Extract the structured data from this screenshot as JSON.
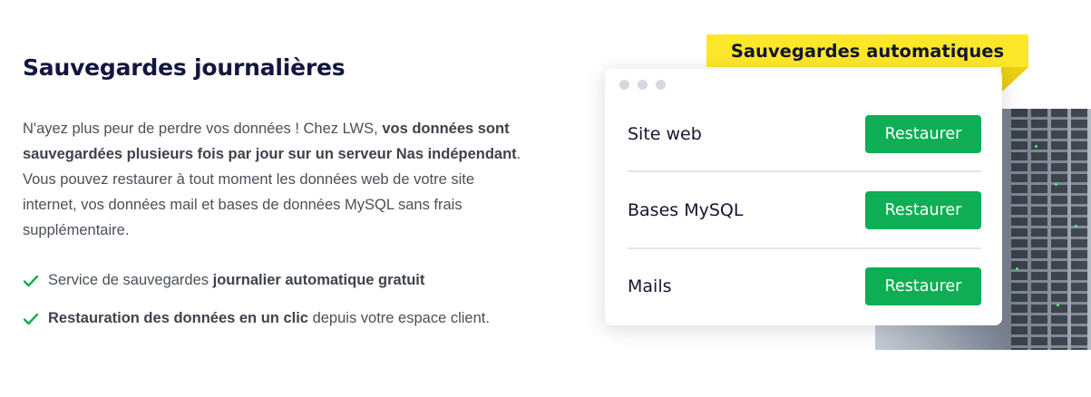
{
  "heading": "Sauvegardes journalières",
  "description": {
    "part1": "N'ayez plus peur de perdre vos données ! Chez LWS, ",
    "bold1": "vos données sont sauvegardées plusieurs fois par jour sur un serveur Nas indépendant",
    "part2": ". Vous pouvez restaurer à tout moment les données web de votre site internet, vos données mail et bases de données MySQL sans frais supplémentaire."
  },
  "features": [
    {
      "pre": "Service de sauvegardes ",
      "bold": "journalier automatique gratuit",
      "post": ""
    },
    {
      "pre": "",
      "bold": "Restauration des données en un clic",
      "post": " depuis votre espace client."
    }
  ],
  "icons": {
    "check": "check-icon",
    "window_dots": "window-dots-icon"
  },
  "colors": {
    "accent_green": "#0fae55",
    "ribbon_yellow": "#fde72a",
    "heading": "#13173f"
  },
  "illustration": {
    "ribbon": "Sauvegardes automatiques",
    "rows": [
      {
        "label": "Site web",
        "button": "Restaurer"
      },
      {
        "label": "Bases MySQL",
        "button": "Restaurer"
      },
      {
        "label": "Mails",
        "button": "Restaurer"
      }
    ]
  }
}
